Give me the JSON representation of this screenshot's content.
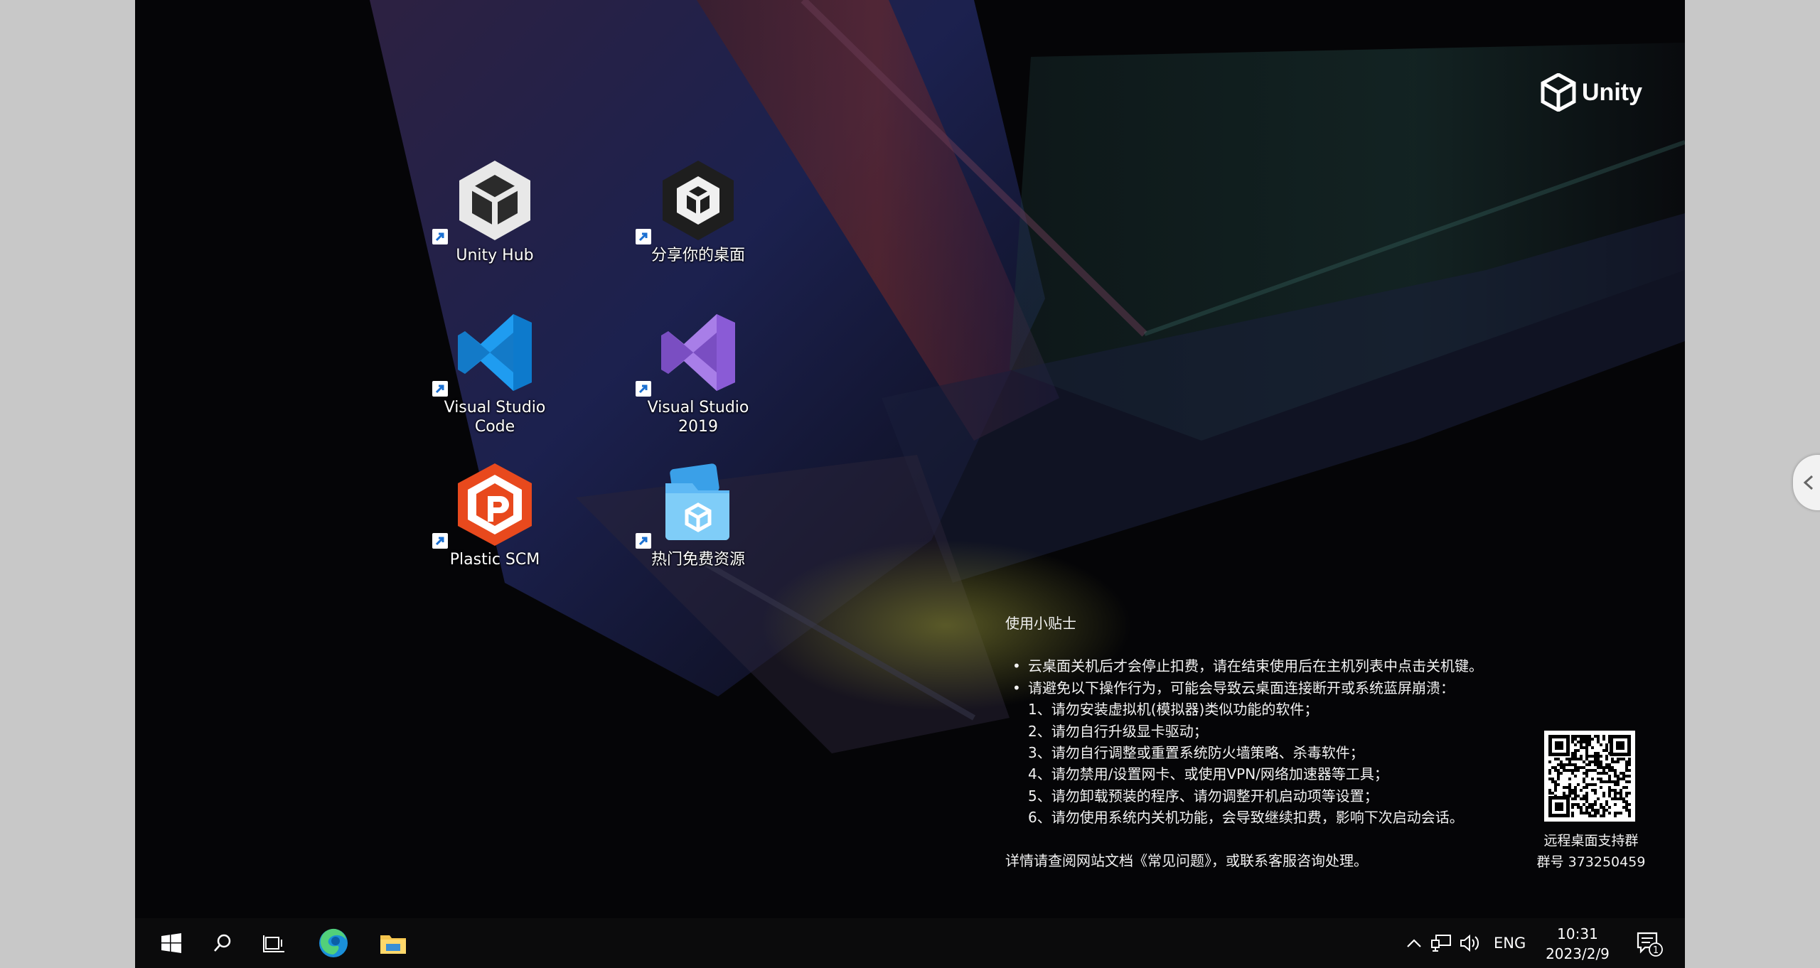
{
  "brand": {
    "logo_text": "Unity"
  },
  "desktop_icons": [
    {
      "label": "Unity Hub",
      "icon": "unity-hub-icon"
    },
    {
      "label": "分享你的桌面",
      "icon": "unity-share-icon"
    },
    {
      "label": "Visual Studio Code",
      "icon": "vscode-icon"
    },
    {
      "label": "Visual Studio 2019",
      "icon": "visual-studio-icon"
    },
    {
      "label": "Plastic SCM",
      "icon": "plastic-scm-icon"
    },
    {
      "label": "热门免费资源",
      "icon": "free-assets-folder-icon"
    }
  ],
  "tips": {
    "title": "使用小贴士",
    "bullets": [
      "云桌面关机后才会停止扣费，请在结束使用后在主机列表中点击关机键。",
      "请避免以下操作行为，可能会导致云桌面连接断开或系统蓝屏崩溃："
    ],
    "items": [
      "1、请勿安装虚拟机(模拟器)类似功能的软件；",
      "2、请勿自行升级显卡驱动；",
      "3、请勿自行调整或重置系统防火墙策略、杀毒软件；",
      "4、请勿禁用/设置网卡、或使用VPN/网络加速器等工具；",
      "5、请勿卸载预装的程序、请勿调整开机启动项等设置；",
      "6、请勿使用系统内关机功能，会导致继续扣费，影响下次启动会话。"
    ],
    "footer": "详情请查阅网站文档《常见问题》，或联系客服咨询处理。"
  },
  "support": {
    "group_title": "远程桌面支持群",
    "group_number": "群号 373250459"
  },
  "taskbar": {
    "items": [
      "start-windows-icon",
      "search-icon",
      "task-view-icon",
      "edge-browser-icon",
      "file-explorer-icon"
    ],
    "tray": [
      "chevron-up-icon",
      "network-icon",
      "volume-icon"
    ],
    "language": "ENG",
    "time": "10:31",
    "date": "2023/2/9",
    "notification_count": "1"
  },
  "colors": {
    "desktop_bg": "#050507",
    "taskbar_bg": "#0b0b0c",
    "vscode_blue": "#0d7acc",
    "vs_purple": "#8a5bd6",
    "plastic_orange": "#e8491d"
  }
}
